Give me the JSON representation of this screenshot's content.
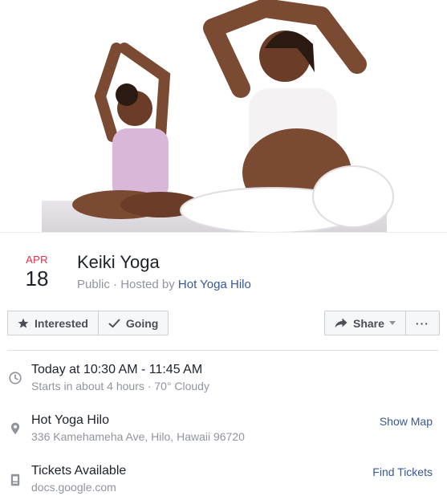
{
  "cover": {
    "alt_kind": "photo"
  },
  "event": {
    "month": "APR",
    "day": "18",
    "title": "Keiki Yoga",
    "visibility": "Public",
    "hosted_by_prefix": "Hosted by",
    "host": "Hot Yoga Hilo"
  },
  "actions": {
    "interested": "Interested",
    "going": "Going",
    "share": "Share",
    "more": "···"
  },
  "details": {
    "time": {
      "main": "Today at 10:30 AM - 11:45 AM",
      "sub": "Starts in about 4 hours · 70° Cloudy"
    },
    "location": {
      "main": "Hot Yoga Hilo",
      "sub": "336 Kamehameha Ave, Hilo, Hawaii 96720",
      "action": "Show Map"
    },
    "tickets": {
      "main": "Tickets Available",
      "sub": "docs.google.com",
      "action": "Find Tickets"
    }
  },
  "colors": {
    "date_month": "#f02849",
    "link": "#365899",
    "muted": "#90949c",
    "text": "#1d2129"
  }
}
